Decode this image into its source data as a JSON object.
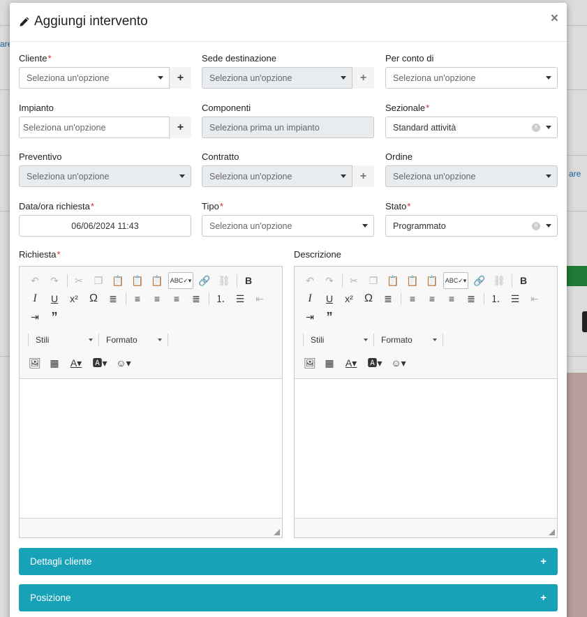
{
  "background": {
    "left_link_fragment": "are",
    "right_link_fragment": "are"
  },
  "modal": {
    "title": "Aggiungi intervento",
    "close_symbol": "×",
    "title_icon": "pencil-icon"
  },
  "fields": {
    "cliente": {
      "label": "Cliente",
      "placeholder": "Seleziona un'opzione"
    },
    "sede": {
      "label": "Sede destinazione",
      "placeholder": "Seleziona un'opzione"
    },
    "conto": {
      "label": "Per conto di",
      "placeholder": "Seleziona un'opzione"
    },
    "impianto": {
      "label": "Impianto",
      "placeholder": "Seleziona un'opzione"
    },
    "componenti": {
      "label": "Componenti",
      "placeholder": "Seleziona prima un impianto"
    },
    "sezionale": {
      "label": "Sezionale",
      "value": "Standard attività"
    },
    "preventivo": {
      "label": "Preventivo",
      "placeholder": "Seleziona un'opzione"
    },
    "contratto": {
      "label": "Contratto",
      "placeholder": "Seleziona un'opzione"
    },
    "ordine": {
      "label": "Ordine",
      "placeholder": "Seleziona un'opzione"
    },
    "data": {
      "label": "Data/ora richiesta",
      "value": "06/06/2024 11:43"
    },
    "tipo": {
      "label": "Tipo",
      "placeholder": "Seleziona un'opzione"
    },
    "stato": {
      "label": "Stato",
      "value": "Programmato"
    }
  },
  "required_mark": "*",
  "add_symbol": "+",
  "editors": {
    "richiesta": {
      "label": "Richiesta"
    },
    "descrizione": {
      "label": "Descrizione"
    },
    "styles_label": "Stili",
    "format_label": "Formato"
  },
  "accordions": {
    "dettagli": {
      "label": "Dettagli cliente"
    },
    "posizione": {
      "label": "Posizione"
    },
    "expand_symbol": "+"
  },
  "colors": {
    "accordion": "#17a2b8",
    "required": "#d9232d",
    "background_green": "#1f7a36"
  }
}
